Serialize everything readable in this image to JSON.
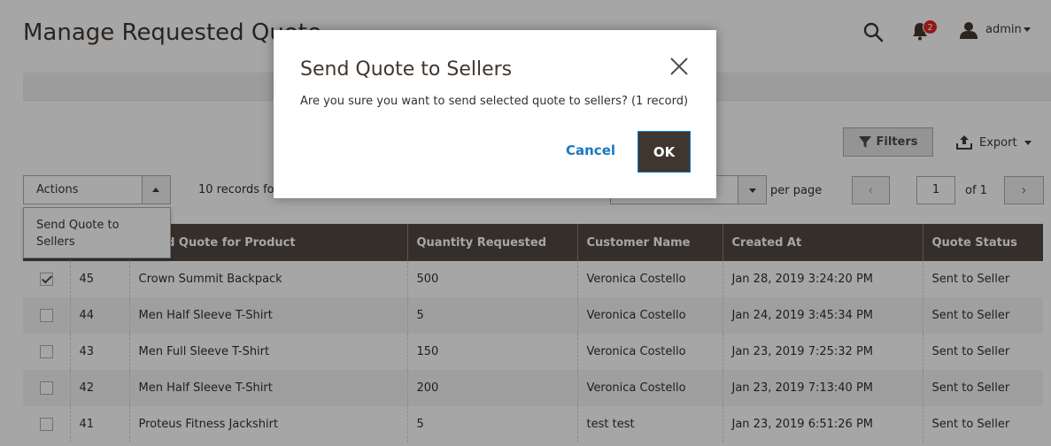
{
  "page": {
    "title": "Manage Requested Quote"
  },
  "header": {
    "notifications_count": "2",
    "user_name": "admin"
  },
  "toolbar": {
    "filters_label": "Filters",
    "export_label": "Export"
  },
  "actions": {
    "label": "Actions",
    "menu_items": [
      "Send Quote to Sellers"
    ]
  },
  "records": {
    "found_text": "10 records fo"
  },
  "pager": {
    "per_page_label": "per page",
    "current_page": "1",
    "total_text": "of 1",
    "prev_symbol": "‹",
    "next_symbol": "›"
  },
  "table": {
    "columns": [
      "",
      "ested Quote for Product",
      "Quantity Requested",
      "Customer Name",
      "Created At",
      "Quote Status"
    ],
    "rows": [
      {
        "checked": true,
        "id": "45",
        "product": "Crown Summit Backpack",
        "qty": "500",
        "customer": "Veronica Costello",
        "created": "Jan 28, 2019 3:24:20 PM",
        "status": "Sent to Seller"
      },
      {
        "checked": false,
        "id": "44",
        "product": "Men Half Sleeve T-Shirt",
        "qty": "5",
        "customer": "Veronica Costello",
        "created": "Jan 24, 2019 3:45:34 PM",
        "status": "Sent to Seller"
      },
      {
        "checked": false,
        "id": "43",
        "product": "Men Full Sleeve T-Shirt",
        "qty": "150",
        "customer": "Veronica Costello",
        "created": "Jan 23, 2019 7:25:32 PM",
        "status": "Sent to Seller"
      },
      {
        "checked": false,
        "id": "42",
        "product": "Men Half Sleeve T-Shirt",
        "qty": "200",
        "customer": "Veronica Costello",
        "created": "Jan 23, 2019 7:13:40 PM",
        "status": "Sent to Seller"
      },
      {
        "checked": false,
        "id": "41",
        "product": "Proteus Fitness Jackshirt",
        "qty": "5",
        "customer": "test test",
        "created": "Jan 23, 2019 6:51:26 PM",
        "status": "Sent to Seller"
      }
    ]
  },
  "modal": {
    "title": "Send Quote to Sellers",
    "message": "Are you sure you want to send selected quote to sellers? (1 record)",
    "cancel_label": "Cancel",
    "ok_label": "OK"
  }
}
